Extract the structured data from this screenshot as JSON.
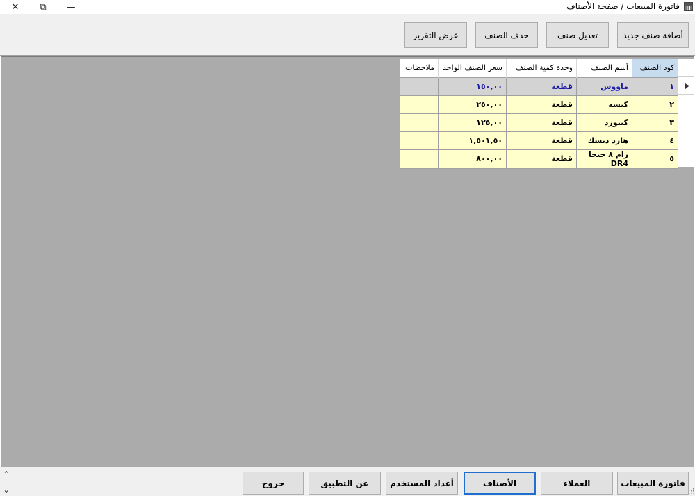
{
  "window": {
    "title": "فاتورة المبيعات / صفحة الأصناف",
    "close_glyph": "✕",
    "maximize_glyph": "⧉",
    "minimize_glyph": "—"
  },
  "toolbar": {
    "add_label": "أضافة صنف جديد",
    "edit_label": "تعديل صنف",
    "delete_label": "حذف الصنف",
    "report_label": "عرض التقرير"
  },
  "grid": {
    "columns": [
      "كود الصنف",
      "أسم الصنف",
      "وحدة كمية الصنف",
      "سعر الصنف الواحد",
      "ملاحظات"
    ],
    "rows": [
      {
        "code": "١",
        "name": "ماووس",
        "unit": "قطعة",
        "price": "١٥٠,٠٠",
        "notes": ""
      },
      {
        "code": "٢",
        "name": "كيسه",
        "unit": "قطعة",
        "price": "٢٥٠,٠٠",
        "notes": ""
      },
      {
        "code": "٣",
        "name": "كيبورد",
        "unit": "قطعة",
        "price": "١٢٥,٠٠",
        "notes": ""
      },
      {
        "code": "٤",
        "name": "هارد ديسك",
        "unit": "قطعة",
        "price": "١,٥٠١,٥٠",
        "notes": ""
      },
      {
        "code": "٥",
        "name": "رام ٨ جيجا DR4",
        "unit": "قطعة",
        "price": "٨٠٠,٠٠",
        "notes": ""
      }
    ]
  },
  "nav": {
    "sales_invoice": "فاتورة المبيعات",
    "customers": "العملاء",
    "items": "الأصناف",
    "user_settings": "أعداد المستخدم",
    "about": "عن التطبيق",
    "exit": "خروج"
  },
  "colors": {
    "row_fill": "#ffffcc",
    "selected_row": "#d3d3d3",
    "selected_text": "#1a1aa8",
    "active_border": "#1f6fd0",
    "grid_background": "#ababab"
  },
  "icons": {
    "app": "app-window-icon",
    "row_pointer": "row-pointer-icon",
    "scroll_up": "chevron-up-icon",
    "scroll_down": "chevron-down-icon"
  }
}
